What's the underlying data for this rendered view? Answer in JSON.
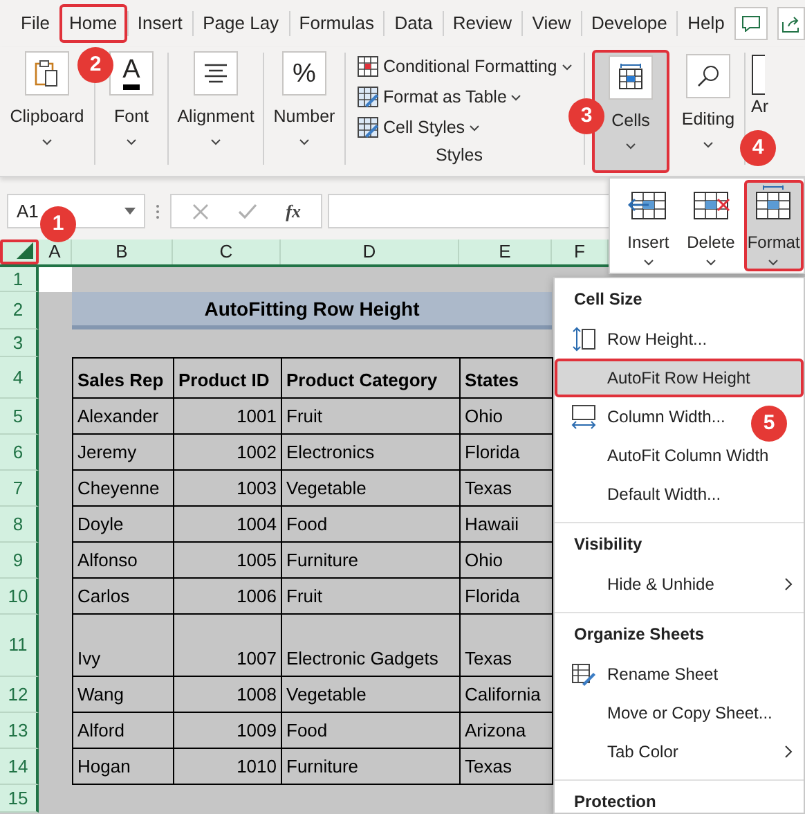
{
  "tabs": [
    {
      "label": "File",
      "highlighted": false
    },
    {
      "label": "Home",
      "highlighted": true
    },
    {
      "label": "Insert",
      "highlighted": false
    },
    {
      "label": "Page Lay",
      "highlighted": false
    },
    {
      "label": "Formulas",
      "highlighted": false
    },
    {
      "label": "Data",
      "highlighted": false
    },
    {
      "label": "Review",
      "highlighted": false
    },
    {
      "label": "View",
      "highlighted": false
    },
    {
      "label": "Develope",
      "highlighted": false
    },
    {
      "label": "Help",
      "highlighted": false
    }
  ],
  "ribbon": {
    "big_groups": [
      {
        "label": "Clipboard"
      },
      {
        "label": "Font",
        "glyph": "A"
      },
      {
        "label": "Alignment"
      },
      {
        "label": "Number",
        "glyph": "%"
      }
    ],
    "styles": {
      "items": [
        "Conditional Formatting",
        "Format as Table",
        "Cell Styles"
      ],
      "label": "Styles"
    },
    "cells": {
      "label": "Cells",
      "selected": true,
      "highlighted": true
    },
    "editing": {
      "label": "Editing"
    },
    "cut_group": {
      "label": "Ar"
    }
  },
  "formula_bar": {
    "name_box": "A1",
    "fx": "fx"
  },
  "columns": [
    "A",
    "B",
    "C",
    "D",
    "E",
    "F"
  ],
  "rows": [
    "1",
    "2",
    "3",
    "4",
    "5",
    "6",
    "7",
    "8",
    "9",
    "10",
    "11",
    "12",
    "13",
    "14",
    "15"
  ],
  "corner_highlighted": true,
  "sheet": {
    "title": "AutoFitting Row Height",
    "headers": [
      "Sales Rep",
      "Product ID",
      "Product Category",
      "States"
    ],
    "records": [
      [
        "Alexander",
        "1001",
        "Fruit",
        "Ohio"
      ],
      [
        "Jeremy",
        "1002",
        "Electronics",
        "Florida"
      ],
      [
        "Cheyenne",
        "1003",
        "Vegetable",
        "Texas"
      ],
      [
        "Doyle",
        "1004",
        "Food",
        "Hawaii"
      ],
      [
        "Alfonso",
        "1005",
        "Furniture",
        "Ohio"
      ],
      [
        "Carlos",
        "1006",
        "Fruit",
        "Florida"
      ],
      [
        "Ivy",
        "1007",
        "Electronic Gadgets",
        "Texas"
      ],
      [
        "Wang",
        "1008",
        "Vegetable",
        "California"
      ],
      [
        "Alford",
        "1009",
        "Food",
        "Arizona"
      ],
      [
        "Hogan",
        "1010",
        "Furniture",
        "Texas"
      ]
    ]
  },
  "cells_panel": [
    {
      "label": "Insert",
      "selected": false,
      "highlighted": false
    },
    {
      "label": "Delete",
      "selected": false,
      "highlighted": false
    },
    {
      "label": "Format",
      "selected": true,
      "highlighted": true
    }
  ],
  "format_menu": [
    {
      "title": "Cell Size",
      "items": [
        {
          "label": "Row Height...",
          "selected": false,
          "highlighted": false,
          "submenu": false
        },
        {
          "label": "AutoFit Row Height",
          "selected": true,
          "highlighted": true,
          "submenu": false
        },
        {
          "label": "Column Width...",
          "selected": false,
          "highlighted": false,
          "submenu": false
        },
        {
          "label": "AutoFit Column Width",
          "selected": false,
          "highlighted": false,
          "submenu": false
        },
        {
          "label": "Default Width...",
          "selected": false,
          "highlighted": false,
          "submenu": false
        }
      ]
    },
    {
      "title": "Visibility",
      "items": [
        {
          "label": "Hide & Unhide",
          "selected": false,
          "highlighted": false,
          "submenu": true
        }
      ]
    },
    {
      "title": "Organize Sheets",
      "items": [
        {
          "label": "Rename Sheet",
          "selected": false,
          "highlighted": false,
          "submenu": false
        },
        {
          "label": "Move or Copy Sheet...",
          "selected": false,
          "highlighted": false,
          "submenu": false
        },
        {
          "label": "Tab Color",
          "selected": false,
          "highlighted": false,
          "submenu": true
        }
      ]
    },
    {
      "title": "Protection"
    }
  ],
  "step_badges": [
    "1",
    "2",
    "3",
    "4",
    "5"
  ]
}
